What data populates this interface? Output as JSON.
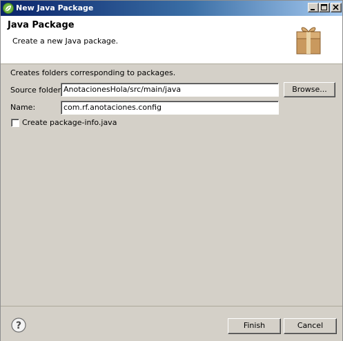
{
  "window": {
    "title": "New Java Package"
  },
  "header": {
    "title": "Java Package",
    "description": "Create a new Java package.",
    "icon": "package-icon"
  },
  "form": {
    "info_text": "Creates folders corresponding to packages.",
    "source_folder_label": "Source folder:",
    "source_folder_value": "AnotacionesHola/src/main/java",
    "browse_label": "Browse...",
    "name_label": "Name:",
    "name_value": "com.rf.anotaciones.config",
    "create_package_info_label": "Create package-info.java",
    "create_package_info_checked": false
  },
  "footer": {
    "help_icon": "help-icon",
    "finish_label": "Finish",
    "cancel_label": "Cancel"
  },
  "colors": {
    "titlebar_start": "#0a246a",
    "titlebar_end": "#a6caf0",
    "dialog_background": "#d4d0c8"
  }
}
